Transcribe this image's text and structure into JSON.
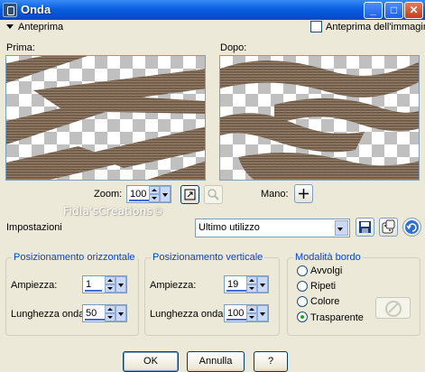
{
  "window": {
    "title": "Onda",
    "minimize": "_",
    "maximize": "□",
    "close": "✕"
  },
  "preview_section": {
    "label": "Anteprima",
    "image_preview_label": "Anteprima dell'immagine",
    "image_preview_checked": false,
    "before_label": "Prima:",
    "after_label": "Dopo:",
    "zoom_label": "Zoom:",
    "zoom_value": "100",
    "hand_label": "Mano:"
  },
  "watermark": "Fidia'sCreations©",
  "settings": {
    "label": "Impostazioni",
    "preset_value": "Ultimo utilizzo"
  },
  "horizontal": {
    "title": "Posizionamento orizzontale",
    "amplitude_label": "Ampiezza:",
    "amplitude_value": "1",
    "wavelength_label": "Lunghezza onda:",
    "wavelength_value": "50"
  },
  "vertical": {
    "title": "Posizionamento verticale",
    "amplitude_label": "Ampiezza:",
    "amplitude_value": "19",
    "wavelength_label": "Lunghezza onda:",
    "wavelength_value": "100"
  },
  "edge_mode": {
    "title": "Modalità bordo",
    "options": [
      "Avvolgi",
      "Ripeti",
      "Colore",
      "Trasparente"
    ],
    "selected": "Trasparente"
  },
  "buttons": {
    "ok": "OK",
    "cancel": "Annulla",
    "help": "?"
  },
  "colors": {
    "title_bar": "#0550d4",
    "group_title": "#0046d5",
    "dialog_bg": "#ece9d8",
    "accent_icon": "#3c6ad8"
  }
}
